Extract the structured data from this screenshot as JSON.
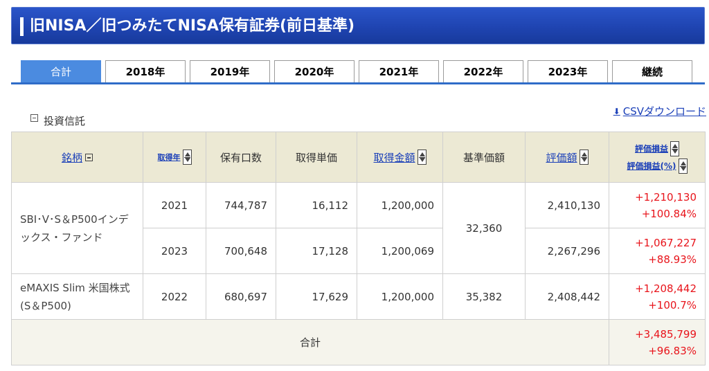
{
  "page": {
    "title": "旧NISA／旧つみたてNISA保有証券(前日基準)"
  },
  "tabs": [
    {
      "label": "合計",
      "active": true
    },
    {
      "label": "2018年",
      "active": false
    },
    {
      "label": "2019年",
      "active": false
    },
    {
      "label": "2020年",
      "active": false
    },
    {
      "label": "2021年",
      "active": false
    },
    {
      "label": "2022年",
      "active": false
    },
    {
      "label": "2023年",
      "active": false
    },
    {
      "label": "継続",
      "active": false
    }
  ],
  "section": {
    "label": "投資信託",
    "csv_link": "CSVダウンロード"
  },
  "table": {
    "headers": {
      "name": "銘柄",
      "year": "取得年",
      "units": "保有口数",
      "unit_price": "取得単価",
      "amount": "取得金額",
      "base_price": "基準価額",
      "valuation": "評価額",
      "pl": "評価損益",
      "pl_pct": "評価損益(%)"
    },
    "funds": [
      {
        "name": "SBI･V･S＆P500インデックス・ファンド",
        "base_price": "32,360",
        "lots": [
          {
            "year": "2021",
            "units": "744,787",
            "unit_price": "16,112",
            "amount": "1,200,000",
            "valuation": "2,410,130",
            "pl": "+1,210,130",
            "pl_pct": "+100.84%"
          },
          {
            "year": "2023",
            "units": "700,648",
            "unit_price": "17,128",
            "amount": "1,200,069",
            "valuation": "2,267,296",
            "pl": "+1,067,227",
            "pl_pct": "+88.93%"
          }
        ]
      },
      {
        "name": "eMAXIS Slim 米国株式(S＆P500)",
        "base_price": "35,382",
        "lots": [
          {
            "year": "2022",
            "units": "680,697",
            "unit_price": "17,629",
            "amount": "1,200,000",
            "valuation": "2,408,442",
            "pl": "+1,208,442",
            "pl_pct": "+100.7%"
          }
        ]
      }
    ],
    "total": {
      "label": "合計",
      "pl": "+3,485,799",
      "pl_pct": "+96.83%"
    }
  },
  "colors": {
    "title_bar": "#1f44b1",
    "tab_active": "#4b8be0",
    "header_bg": "#ece9d4",
    "gain": "#e8141b",
    "link": "#1a3fb8"
  }
}
